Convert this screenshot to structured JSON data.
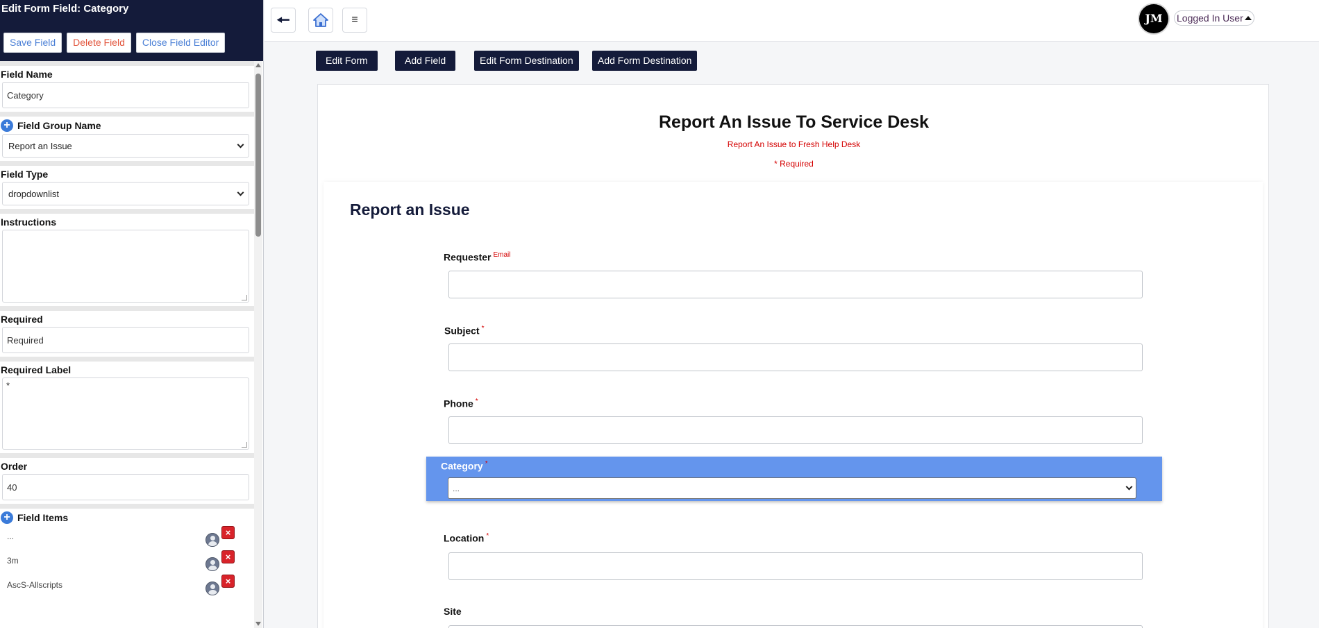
{
  "editor": {
    "title": "Edit Form Field: Category",
    "actions": {
      "save": "Save Field",
      "delete": "Delete Field",
      "close": "Close Field Editor"
    },
    "field_name": {
      "label": "Field Name",
      "value": "Category"
    },
    "field_group": {
      "label": "Field Group Name",
      "value": "Report an Issue"
    },
    "field_type": {
      "label": "Field Type",
      "value": "dropdownlist"
    },
    "instructions": {
      "label": "Instructions",
      "value": ""
    },
    "required": {
      "label": "Required",
      "value": "Required"
    },
    "required_label": {
      "label": "Required Label",
      "value": "*"
    },
    "order": {
      "label": "Order",
      "value": "40"
    },
    "field_items": {
      "label": "Field Items",
      "items": [
        "...",
        "3m",
        "AscS-Allscripts"
      ]
    }
  },
  "topbar": {
    "avatar_initials": "JM",
    "user_label": "Logged In User"
  },
  "toolbar": {
    "edit_form": "Edit Form",
    "add_field": "Add Field",
    "edit_destination": "Edit Form Destination",
    "add_destination": "Add Form Destination"
  },
  "form": {
    "title": "Report An Issue To Service Desk",
    "subtitle": "Report An Issue to Fresh Help Desk",
    "required_note": "* Required",
    "section_title": "Report an Issue",
    "fields": {
      "requester": {
        "label": "Requester",
        "marker": "Email"
      },
      "subject": {
        "label": "Subject",
        "marker": "*"
      },
      "phone": {
        "label": "Phone",
        "marker": "*"
      },
      "category": {
        "label": "Category",
        "marker": "*",
        "value": "..."
      },
      "location": {
        "label": "Location",
        "marker": "*"
      },
      "site": {
        "label": "Site",
        "marker": ""
      }
    }
  },
  "colors": {
    "nav_dark": "#141b3a",
    "highlight": "#6495ed",
    "required_red": "#d40000",
    "link_blue": "#4a7fd6",
    "delete_red": "#e2553c"
  }
}
